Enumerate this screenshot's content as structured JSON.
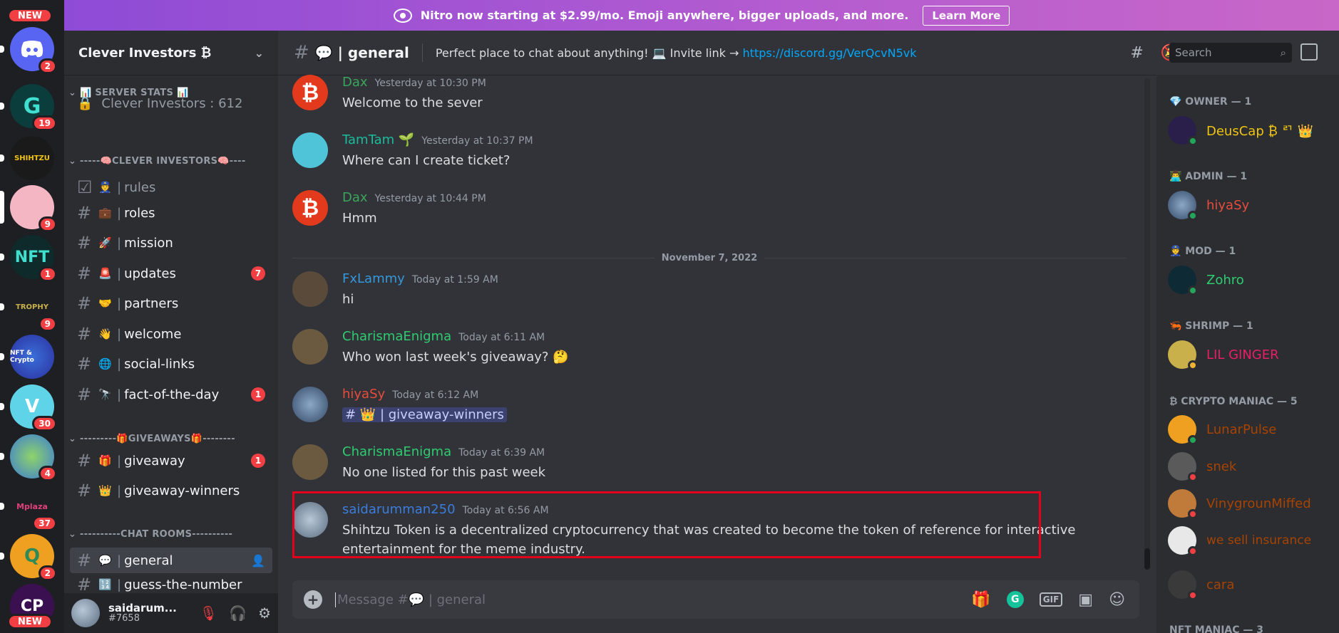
{
  "banner": {
    "text": "Nitro now starting at $2.99/mo. Emoji anywhere, bigger uploads, and more.",
    "button": "Learn More"
  },
  "rail": {
    "new_top": "NEW",
    "new_bottom": "NEW",
    "servers": [
      {
        "badge": "2"
      },
      {
        "badge": "19"
      },
      {
        "badge": ""
      },
      {
        "badge": "9"
      },
      {
        "badge": "1"
      },
      {
        "badge": "9"
      },
      {
        "badge": ""
      },
      {
        "badge": "30"
      },
      {
        "badge": "4"
      },
      {
        "badge": "37"
      },
      {
        "badge": "2"
      }
    ]
  },
  "server": {
    "name": "Clever Investors ₿",
    "categories": {
      "stats": "📊 SERVER STATS 📊",
      "investors": "-----🧠CLEVER INVESTORS🧠----",
      "giveaways": "---------🎁GIVEAWAYS🎁--------",
      "chatrooms": "----------CHAT ROOMS----------"
    },
    "stats_channel": "Clever Investors : 612",
    "channels": [
      {
        "emoji": "👮",
        "name": "rules",
        "count": ""
      },
      {
        "emoji": "💼",
        "name": "roles",
        "count": ""
      },
      {
        "emoji": "🚀",
        "name": "mission",
        "count": ""
      },
      {
        "emoji": "🚨",
        "name": "updates",
        "count": "7"
      },
      {
        "emoji": "🤝",
        "name": "partners",
        "count": ""
      },
      {
        "emoji": "👋",
        "name": "welcome",
        "count": ""
      },
      {
        "emoji": "🌐",
        "name": "social-links",
        "count": ""
      },
      {
        "emoji": "🔭",
        "name": "fact-of-the-day",
        "count": "1"
      },
      {
        "emoji": "🎁",
        "name": "giveaway",
        "count": "1"
      },
      {
        "emoji": "👑",
        "name": "giveaway-winners",
        "count": ""
      },
      {
        "emoji": "💬",
        "name": "general",
        "count": ""
      },
      {
        "emoji": "🔢",
        "name": "guess-the-number",
        "count": ""
      }
    ]
  },
  "user": {
    "name": "saidarum...",
    "tag": "#7658"
  },
  "header": {
    "channel": "💬 | general",
    "topic": "Perfect place to chat about anything! 💻 Invite link →",
    "link": "https://discord.gg/VerQcvN5vk",
    "search_placeholder": "Search"
  },
  "messages": [
    {
      "author": "Dax",
      "time": "Yesterday at 10:30 PM",
      "text": "Welcome to the sever",
      "color": "#3ba55c"
    },
    {
      "author": "TamTam 🌱",
      "time": "Yesterday at 10:37 PM",
      "text": "Where can I create ticket?",
      "color": "#1abc9c"
    },
    {
      "author": "Dax",
      "time": "Yesterday at 10:44 PM",
      "text": "Hmm",
      "color": "#3ba55c"
    },
    {
      "author": "FxLammy",
      "time": "Today at 1:59 AM",
      "text": "hi",
      "color": "#3498db"
    },
    {
      "author": "CharismaEnigma",
      "time": "Today at 6:11 AM",
      "text": "Who won last week's giveaway? 🤔",
      "color": "#2ecc71"
    },
    {
      "author": "hiyaSy",
      "time": "Today at 6:12 AM",
      "text": "# 👑 | giveaway-winners",
      "color": "#e74c3c"
    },
    {
      "author": "CharismaEnigma",
      "time": "Today at 6:39 AM",
      "text": "No one listed for this past week",
      "color": "#2ecc71"
    },
    {
      "author": "saidarumman250",
      "time": "Today at 6:56 AM",
      "text": "Shihtzu Token is a decentralized cryptocurrency that was created to become the token of reference for interactive",
      "text2": "entertainment for the meme industry.",
      "color": "#3b7ddd"
    }
  ],
  "date_separator": "November 7, 2022",
  "composer": {
    "placeholder": "Message #💬 | general",
    "gif": "GIF"
  },
  "members": {
    "owner_title": "💎 OWNER — 1",
    "admin_title": "👨‍💻 ADMIN — 1",
    "mod_title": "👮 MOD — 1",
    "shrimp_title": "🦐 SHRIMP — 1",
    "crypto_title": "₿ CRYPTO MANIAC — 5",
    "nft_title": "NFT MANIAC — 3",
    "owner": {
      "name": "DeusCap ₿ ᄅᄀ 👑",
      "color": "#f1c40f"
    },
    "admin": {
      "name": "hiyaSy",
      "color": "#e74c3c"
    },
    "mod": {
      "name": "Zohro",
      "color": "#2ecc71"
    },
    "shrimp": {
      "name": "LIL GINGER",
      "color": "#e91e63"
    },
    "crypto": [
      {
        "name": "LunarPulse",
        "color": "#a84300"
      },
      {
        "name": "snek",
        "color": "#a84300"
      },
      {
        "name": "VinygrounMiffed",
        "color": "#a84300"
      },
      {
        "name": "we sell insurance",
        "color": "#a84300"
      },
      {
        "name": "cara",
        "color": "#a84300"
      }
    ]
  }
}
